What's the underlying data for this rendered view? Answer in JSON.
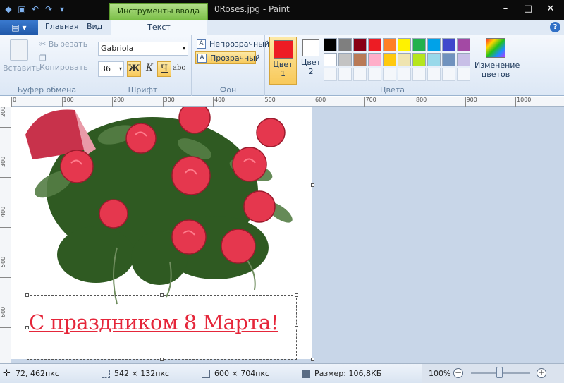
{
  "title": {
    "context_tab": "Инструменты ввода текста",
    "window_title": "0Roses.jpg - Paint",
    "window_buttons": [
      "–",
      "□",
      "✕"
    ]
  },
  "tabs": {
    "app_menu": "▤ ▾",
    "items": [
      "Главная",
      "Вид",
      "Текст"
    ],
    "help": "?"
  },
  "clipboard": {
    "paste": "Вставить",
    "cut": "Вырезать",
    "copy": "Копировать",
    "label": "Буфер обмена"
  },
  "font": {
    "family": "Gabriola",
    "size": "36",
    "bold": "Ж",
    "italic": "К",
    "underline": "Ч",
    "strike": "abc",
    "label": "Шрифт"
  },
  "background": {
    "opaque": "Непрозрачный",
    "transparent": "Прозрачный",
    "label": "Фон"
  },
  "colors": {
    "color1": "Цвет",
    "color1_num": "1",
    "color2": "Цвет",
    "color2_num": "2",
    "edit_line1": "Изменение",
    "edit_line2": "цветов",
    "label": "Цвета",
    "color1_value": "#ed1c24",
    "color2_value": "#ffffff",
    "palette_row1": [
      "#000000",
      "#7f7f7f",
      "#880015",
      "#ed1c24",
      "#ff7f27",
      "#fff200",
      "#22b14c",
      "#00a2e8",
      "#3f48cc",
      "#a349a4"
    ],
    "palette_row2": [
      "#ffffff",
      "#c3c3c3",
      "#b97a57",
      "#ffaec9",
      "#ffc90e",
      "#efe4b0",
      "#b5e61d",
      "#99d9ea",
      "#7092be",
      "#c8bfe7"
    ]
  },
  "ruler": {
    "h_ticks": [
      "0",
      "100",
      "200",
      "300",
      "400",
      "500",
      "600",
      "700",
      "800",
      "900",
      "1000"
    ],
    "v_ticks": [
      "200",
      "300",
      "400",
      "500",
      "600"
    ]
  },
  "canvas": {
    "greeting": "С праздником 8 Марта!"
  },
  "status": {
    "cursor_pos": "72, 462пкс",
    "selection_size": "542 × 132пкс",
    "image_size": "600 × 704пкс",
    "file_size": "Размер: 106,8КБ",
    "zoom": "100%",
    "zoom_minus": "−",
    "zoom_plus": "+"
  }
}
